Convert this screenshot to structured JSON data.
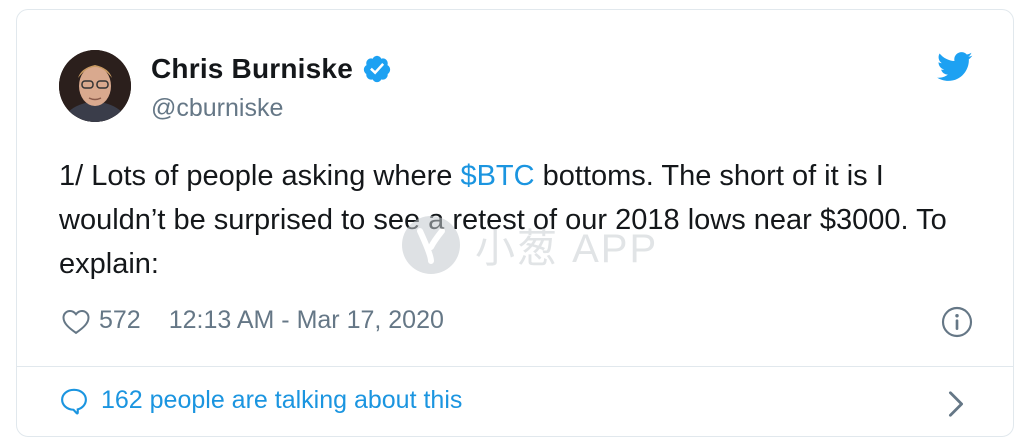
{
  "author": {
    "name": "Chris Burniske",
    "handle": "@cburniske",
    "verified": true
  },
  "tweet": {
    "text_before": "1/ Lots of people asking where ",
    "cashtag": "$BTC",
    "text_after": " bottoms. The short of it is I wouldn’t be surprised to see a retest of our 2018 lows near $3000. To explain:"
  },
  "meta": {
    "likes": "572",
    "timestamp": "12:13 AM - Mar 17, 2020"
  },
  "footer": {
    "talking": "162 people are talking about this"
  },
  "watermark": {
    "text": "小葱 APP"
  },
  "icons": {
    "brand": "twitter-bird-icon",
    "verified": "verified-badge-icon",
    "like": "heart-icon",
    "info": "info-icon",
    "comments": "speech-bubble-icon",
    "more": "chevron-right-icon"
  },
  "colors": {
    "accent": "#1b95e0",
    "twitter_blue": "#1da1f2",
    "secondary_text": "#657786",
    "border": "#e1e8ed"
  }
}
